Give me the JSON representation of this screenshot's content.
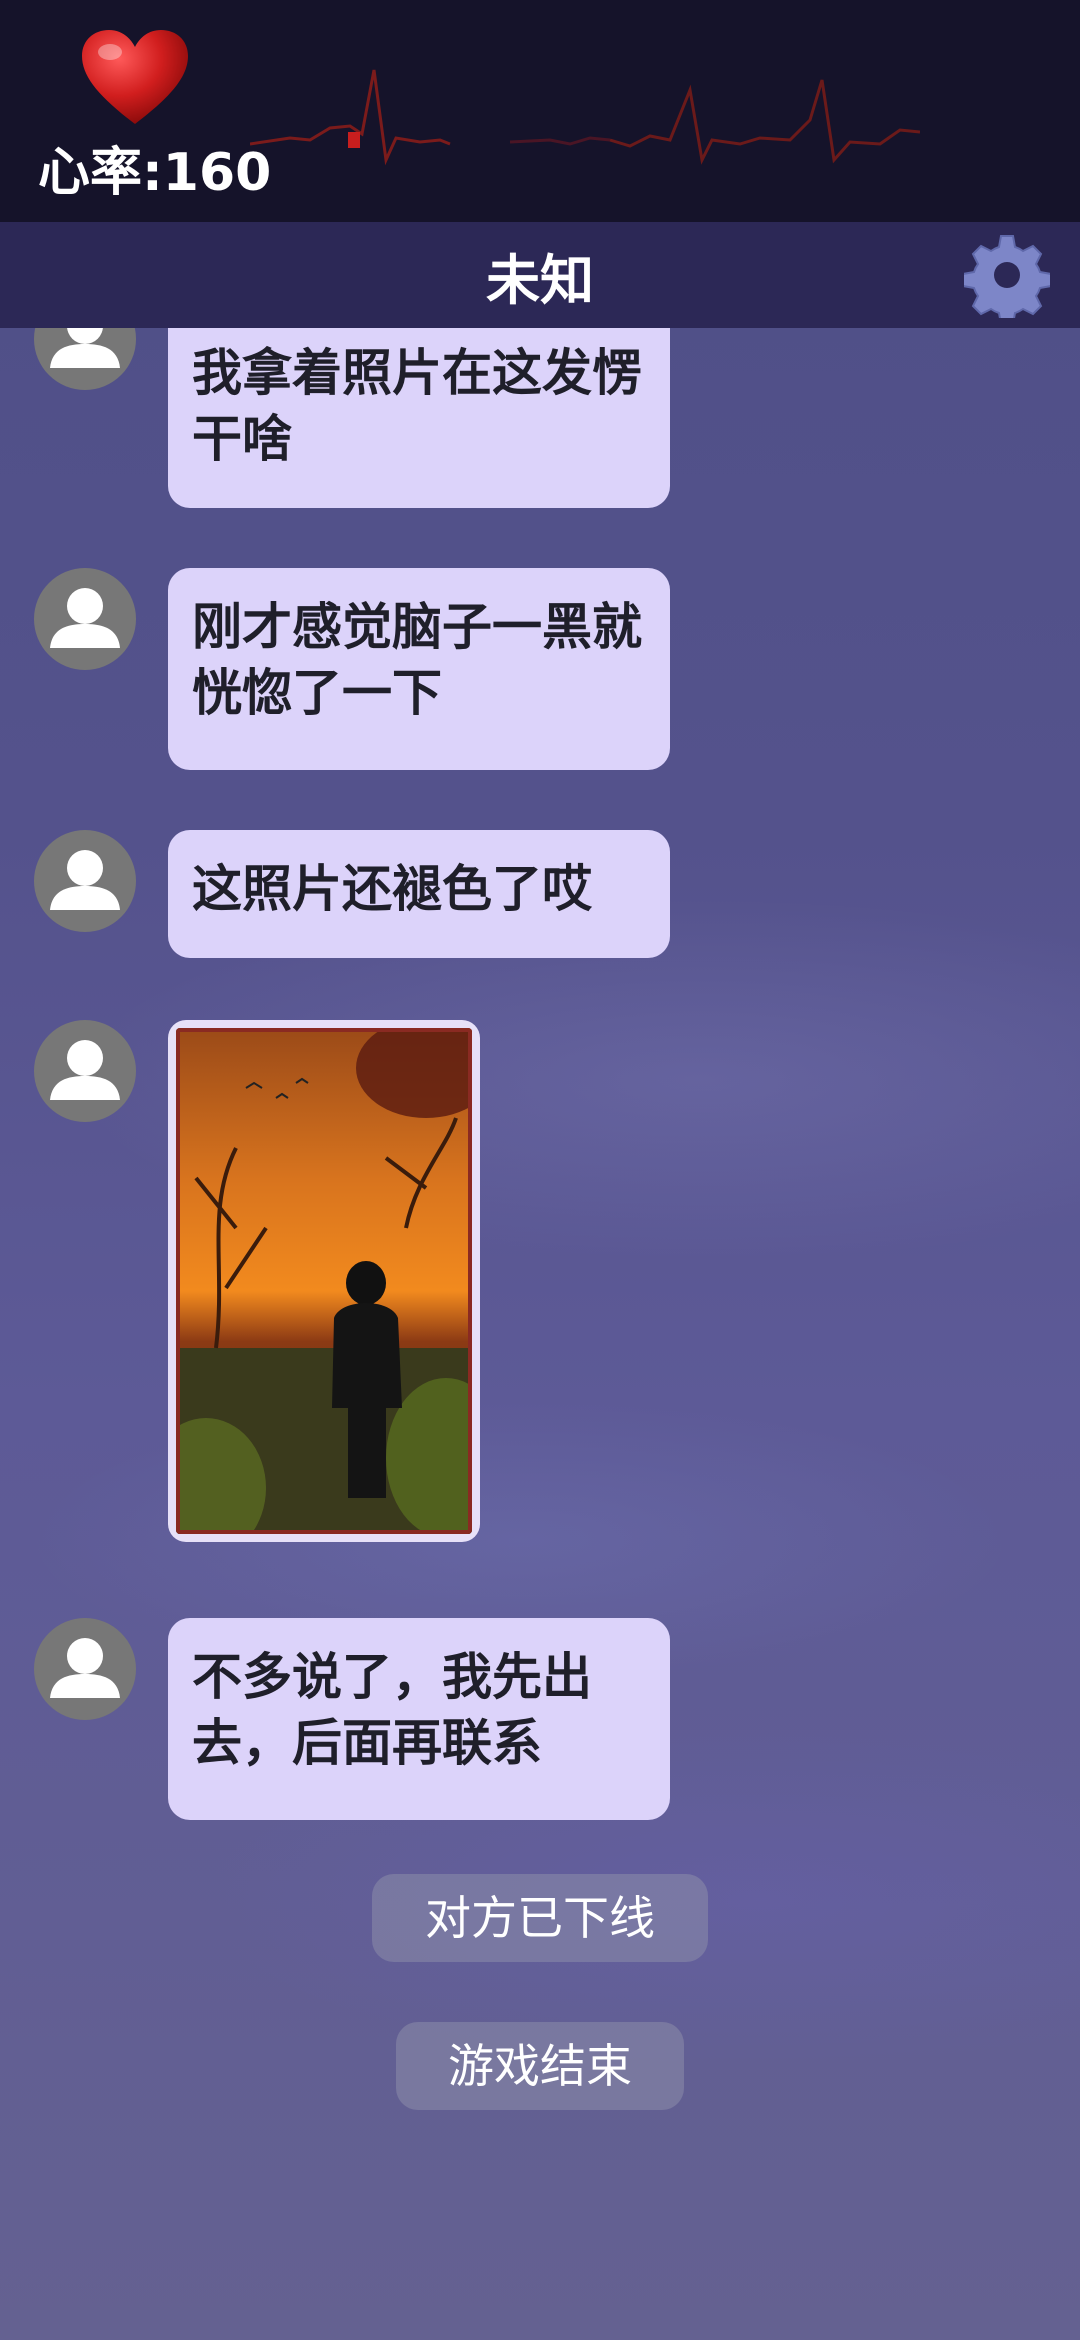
{
  "status": {
    "heart_rate_label": "心率:160",
    "heart_icon": "heart-icon",
    "ecg_color": "#8b1a1a"
  },
  "header": {
    "title": "未知",
    "settings_icon": "gear-icon"
  },
  "messages": [
    {
      "text": "我拿着照片在这发愣干啥"
    },
    {
      "text": "刚才感觉脑子一黑就恍惚了一下"
    },
    {
      "text": "这照片还褪色了哎"
    },
    {
      "type": "image",
      "icon": "photo-image"
    },
    {
      "text": "不多说了，我先出去，后面再联系"
    }
  ],
  "system": {
    "offline": "对方已下线",
    "game_over": "游戏结束"
  },
  "colors": {
    "bubble": "#dcd3fa",
    "status_bar": "#15132a",
    "title_bar": "#2c2856",
    "background": "#55558a"
  }
}
